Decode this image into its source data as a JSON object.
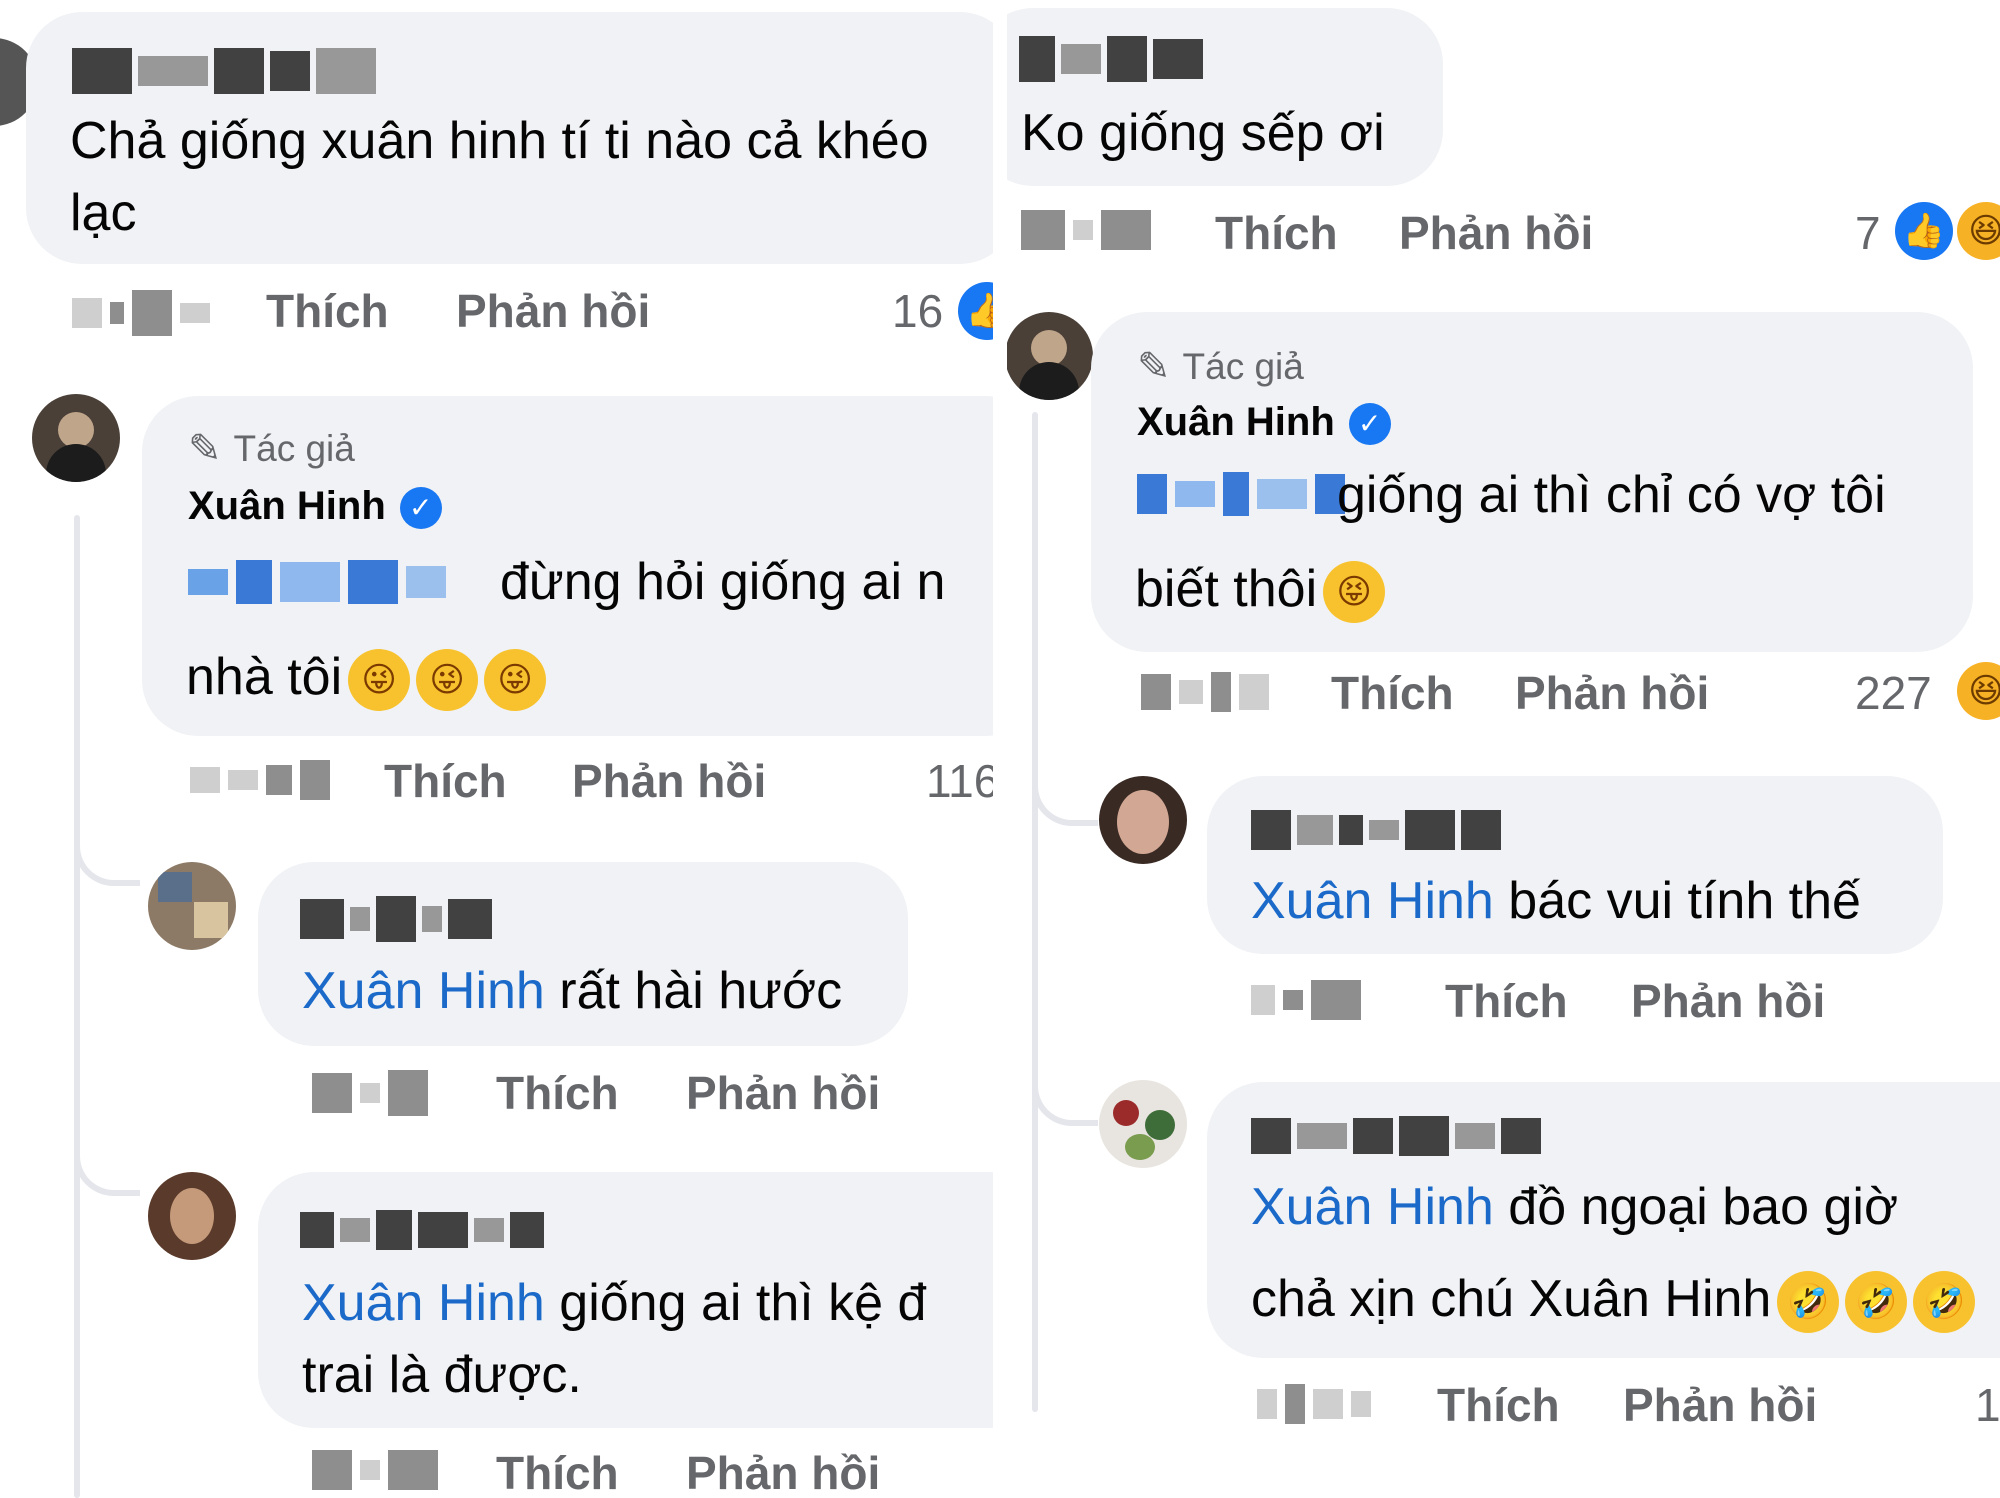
{
  "left": {
    "c1": {
      "text1": "Chả giống xuân hinh tí ti nào cả khéo",
      "text2": "lạc",
      "like": "Thích",
      "reply": "Phản hồi",
      "count": "16"
    },
    "c2": {
      "author_tag": "Tác giả",
      "name": "Xuân Hinh",
      "text1": " đừng hỏi giống ai n",
      "text2": "nhà tôi",
      "like": "Thích",
      "reply": "Phản hồi",
      "count": "116"
    },
    "c3": {
      "mention": "Xuân Hinh",
      "text": " rất hài hước",
      "like": "Thích",
      "reply": "Phản hồi"
    },
    "c4": {
      "mention": "Xuân Hinh",
      "text1": "  giống ai thì  kệ đ",
      "text2": "trai  là  được.",
      "like": "Thích",
      "reply": "Phản hồi"
    }
  },
  "right": {
    "c1": {
      "text": "Ko giống sếp ơi",
      "like": "Thích",
      "reply": "Phản hồi",
      "count": "7"
    },
    "c2": {
      "author_tag": "Tác giả",
      "name": "Xuân Hinh",
      "text1": " giống ai thì chỉ có vợ tôi",
      "text2": "biết thôi",
      "like": "Thích",
      "reply": "Phản hồi",
      "count": "227"
    },
    "c3": {
      "mention": "Xuân Hinh",
      "text": " bác vui tính thế",
      "like": "Thích",
      "reply": "Phản hồi"
    },
    "c4": {
      "mention": "Xuân Hinh",
      "text1": " đồ ngoại bao giờ",
      "text2": "chả xịn chú Xuân Hinh",
      "like": "Thích",
      "reply": "Phản hồi",
      "count": "1"
    }
  },
  "icons": {
    "like": "thumbs-up-icon",
    "haha": "laughing-face-icon",
    "tongue": "winking-tongue-emoji",
    "squint": "squinting-tongue-emoji",
    "rofl": "rolling-laughing-emoji",
    "verified": "verified-badge-icon",
    "pen": "author-pen-icon"
  },
  "colors": {
    "mention": "#1b6ac9",
    "bubble": "#f0f2f5",
    "muted": "#65676b",
    "like_blue": "#1877f2",
    "emoji_yellow": "#f8c22e"
  }
}
